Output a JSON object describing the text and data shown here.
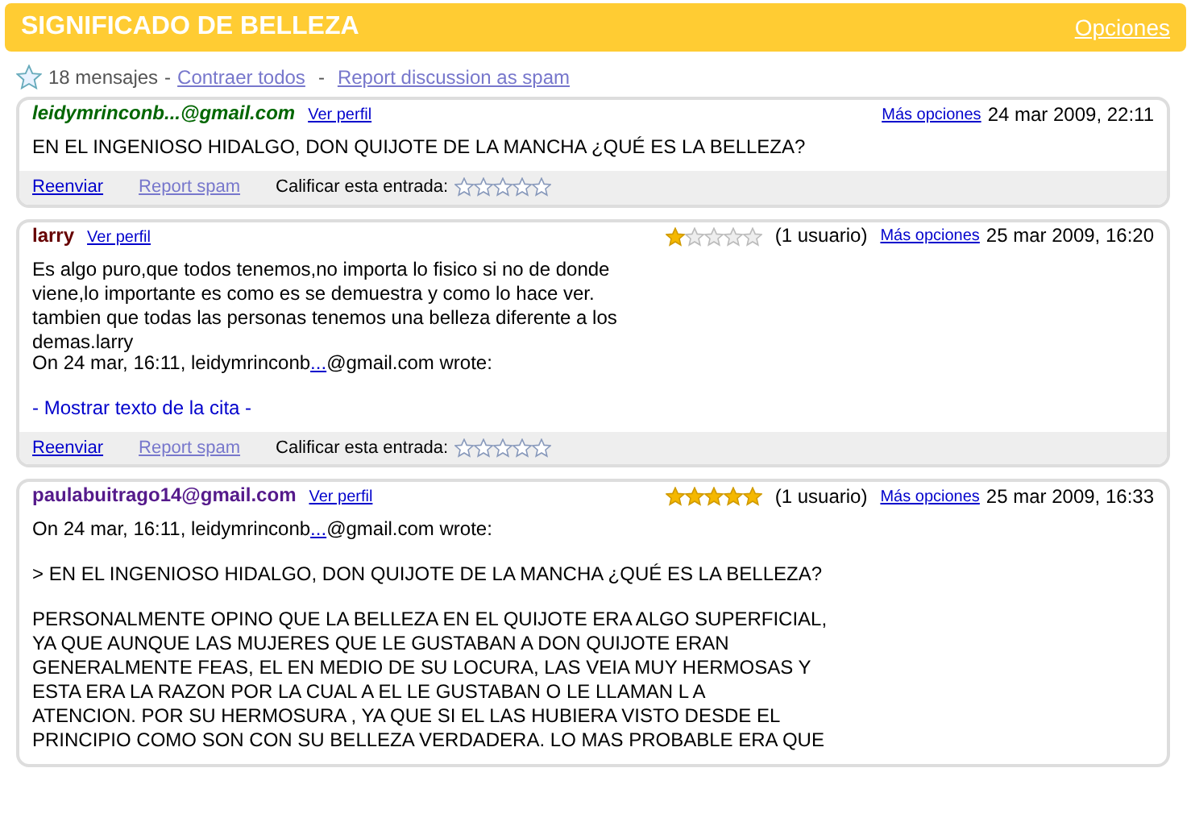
{
  "header": {
    "title": "SIGNIFICADO DE BELLEZA",
    "options_link": "Opciones"
  },
  "toolbar": {
    "starred": false,
    "count": "18 mensajes",
    "separator_1": "-",
    "collapse_link": "Contraer todos",
    "separator_2": "-",
    "report_link": "Report discussion as spam"
  },
  "messages": [
    {
      "author": "leidymrinconb...@gmail.com",
      "color": "#006600",
      "italic": true,
      "profile_link": "Ver perfil",
      "more_options": "Más opciones",
      "date": "24 mar 2009, 22:11",
      "body": [
        {
          "kind": "text",
          "lines": [
            "EN EL INGENIOSO HIDALGO, DON QUIJOTE DE LA MANCHA ¿QUÉ ES LA BELLEZA?"
          ]
        }
      ],
      "footer": {
        "forward": "Reenviar",
        "report_spam": "Report spam",
        "rate_label": "Calificar esta entrada:",
        "rating": {
          "stars": 0
        }
      }
    },
    {
      "author": "larry",
      "color": "#660000",
      "italic": false,
      "profile_link": "Ver perfil",
      "stars": 1,
      "votes": "(1 usuario)",
      "more_options": "Más opciones",
      "date": "25 mar 2009, 16:20",
      "body": [
        {
          "kind": "text",
          "lines": [
            "Es algo puro,que todos tenemos,no importa lo fisico si no de donde",
            "viene,lo importante es como es se demuestra y como lo hace ver.",
            "tambien que todas las personas tenemos una belleza diferente a los",
            "demas.larry"
          ]
        },
        {
          "kind": "wrote",
          "before": "On 24 mar, 16:11, leidymrinconb",
          "link": "...",
          "after": "@gmail.com wrote:"
        },
        {
          "kind": "show_quote",
          "text": "- Mostrar texto de la cita -"
        }
      ],
      "footer": {
        "forward": "Reenviar",
        "report_spam": "Report spam",
        "rate_label": "Calificar esta entrada:",
        "rating": {
          "stars": 0
        }
      }
    },
    {
      "author": "paulabuitrago14@gmail.com",
      "color": "#551a8b",
      "italic": false,
      "profile_link": "Ver perfil",
      "stars": 5,
      "votes": "(1 usuario)",
      "more_options": "Más opciones",
      "date": "25 mar 2009, 16:33",
      "body": [
        {
          "kind": "wrote",
          "before": "On 24 mar, 16:11, leidymrinconb",
          "link": "...",
          "after": "@gmail.com wrote:"
        },
        {
          "kind": "text",
          "lines": [
            "> EN EL INGENIOSO HIDALGO, DON QUIJOTE DE LA MANCHA ¿QUÉ ES LA BELLEZA?"
          ]
        },
        {
          "kind": "text",
          "lines": [
            "PERSONALMENTE OPINO QUE LA BELLEZA EN EL QUIJOTE ERA ALGO SUPERFICIAL,",
            "YA QUE AUNQUE LAS MUJERES QUE LE GUSTABAN A DON QUIJOTE ERAN",
            "GENERALMENTE FEAS, EL EN MEDIO DE SU LOCURA, LAS VEIA MUY HERMOSAS Y",
            "ESTA ERA LA RAZON POR LA CUAL A EL LE GUSTABAN O LE LLAMAN L A",
            "ATENCION. POR SU HERMOSURA , YA QUE SI EL LAS HUBIERA VISTO DESDE EL",
            "PRINCIPIO COMO SON CON SU BELLEZA VERDADERA. LO MAS  PROBABLE ERA QUE"
          ]
        }
      ]
    }
  ]
}
